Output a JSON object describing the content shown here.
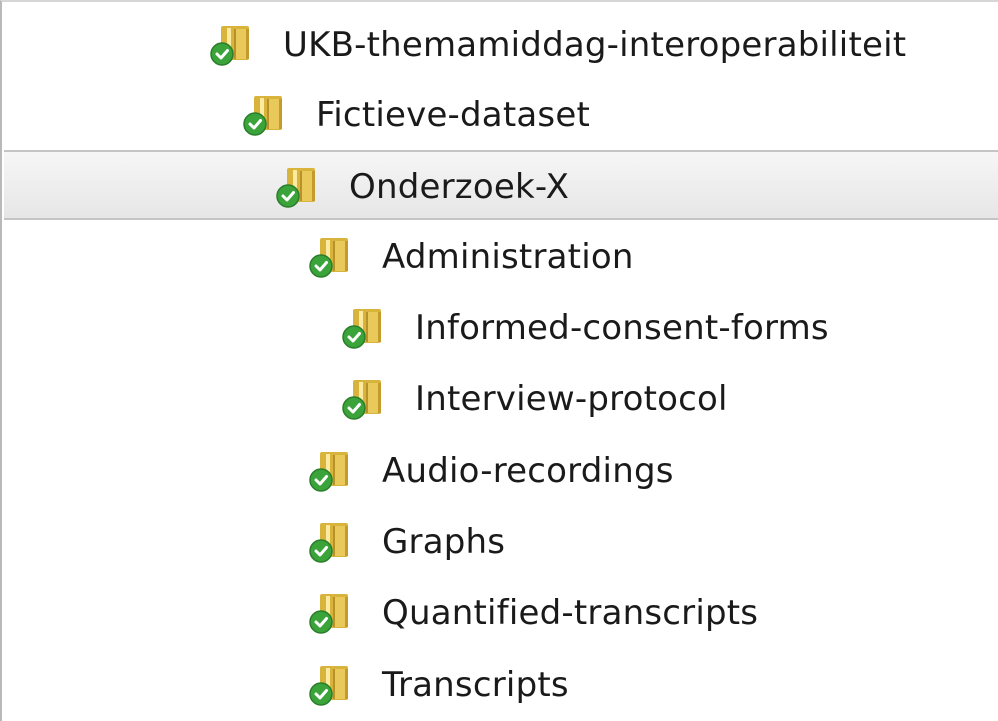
{
  "tree": {
    "items": [
      {
        "label": "UKB-themamiddag-interoperabiliteit",
        "depth": 0,
        "selected": false,
        "icon": "synced-folder-icon"
      },
      {
        "label": "Fictieve-dataset",
        "depth": 1,
        "selected": false,
        "icon": "synced-folder-icon"
      },
      {
        "label": "Onderzoek-X",
        "depth": 2,
        "selected": true,
        "icon": "synced-folder-icon"
      },
      {
        "label": "Administration",
        "depth": 3,
        "selected": false,
        "icon": "synced-folder-icon"
      },
      {
        "label": "Informed-consent-forms",
        "depth": 4,
        "selected": false,
        "icon": "synced-folder-icon"
      },
      {
        "label": "Interview-protocol",
        "depth": 4,
        "selected": false,
        "icon": "synced-folder-icon"
      },
      {
        "label": "Audio-recordings",
        "depth": 3,
        "selected": false,
        "icon": "synced-folder-icon"
      },
      {
        "label": "Graphs",
        "depth": 3,
        "selected": false,
        "icon": "synced-folder-icon"
      },
      {
        "label": "Quantified-transcripts",
        "depth": 3,
        "selected": false,
        "icon": "synced-folder-icon"
      },
      {
        "label": "Transcripts",
        "depth": 3,
        "selected": false,
        "icon": "synced-folder-icon"
      }
    ]
  },
  "colors": {
    "folder": "#e8c95a",
    "sync_badge": "#3aa33a",
    "selection": "#e9e9e9"
  }
}
